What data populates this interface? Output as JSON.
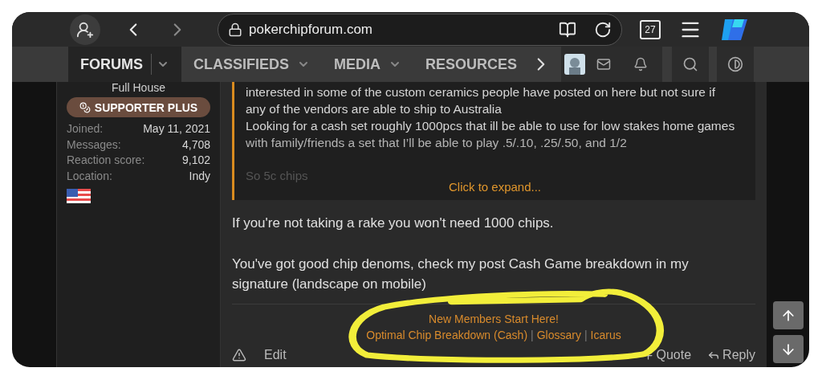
{
  "browser": {
    "url": "pokerchipforum.com",
    "tab_count": "27"
  },
  "nav": {
    "tabs": [
      {
        "label": "FORUMS",
        "selected": true,
        "dropdown": true
      },
      {
        "label": "CLASSIFIEDS",
        "selected": false,
        "dropdown": true
      },
      {
        "label": "MEDIA",
        "selected": false,
        "dropdown": true
      },
      {
        "label": "RESOURCES",
        "selected": false,
        "dropdown": false
      }
    ]
  },
  "user": {
    "rank": "Full House",
    "badge": "SUPPORTER PLUS",
    "stats": [
      {
        "label": "Joined:",
        "value": "May 11, 2021"
      },
      {
        "label": "Messages:",
        "value": "4,708"
      },
      {
        "label": "Reaction score:",
        "value": "9,102"
      },
      {
        "label": "Location:",
        "value": "Indy"
      }
    ]
  },
  "quote": {
    "lines": [
      "interested in some of the custom ceramics people have posted on here but not sure if",
      "any of the vendors are able to ship to Australia",
      "Looking for a cash set roughly 1000pcs that ill be able to use for low stakes home games",
      "with family/friends a set that I’ll be able to play .5/.10, .25/.50, and 1/2"
    ],
    "faded_line": "So 5c chips",
    "expand": "Click to expand..."
  },
  "message": [
    "If you're not taking a rake you won't need 1000 chips.",
    "You've got good chip denoms, check my post Cash Game breakdown in my signature (landscape on mobile)"
  ],
  "signature": {
    "title": "New Members Start Here!",
    "links": [
      "Optimal Chip Breakdown (Cash)",
      "Glossary",
      "Icarus"
    ],
    "separator": "|"
  },
  "actions": {
    "left": [
      "Edit"
    ],
    "quote": "Quote",
    "reply": "Reply"
  }
}
